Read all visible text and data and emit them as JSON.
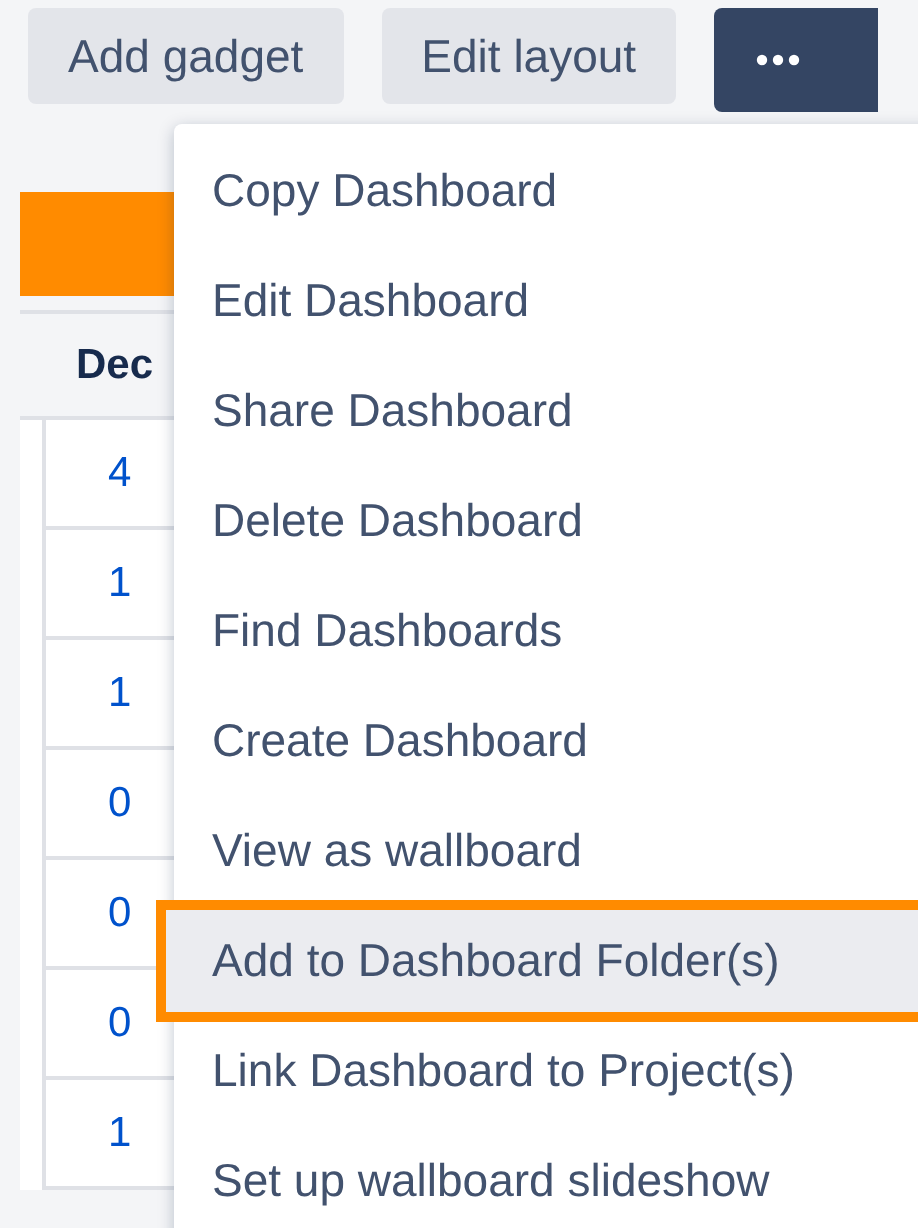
{
  "toolbar": {
    "buttons": [
      "Add gadget",
      "Edit layout"
    ]
  },
  "table": {
    "header": "Dec",
    "rows": [
      "4",
      "1",
      "1",
      "0",
      "0",
      "0",
      "1"
    ]
  },
  "menu": {
    "items": [
      {
        "label": "Copy Dashboard",
        "selected": false
      },
      {
        "label": "Edit Dashboard",
        "selected": false
      },
      {
        "label": "Share Dashboard",
        "selected": false
      },
      {
        "label": "Delete Dashboard",
        "selected": false
      },
      {
        "label": "Find Dashboards",
        "selected": false
      },
      {
        "label": "Create Dashboard",
        "selected": false
      },
      {
        "label": "View as wallboard",
        "selected": false
      },
      {
        "label": "Add to Dashboard Folder(s)",
        "selected": true
      },
      {
        "label": "Link Dashboard to Project(s)",
        "selected": false
      },
      {
        "label": "Set up wallboard slideshow",
        "selected": false
      }
    ]
  }
}
